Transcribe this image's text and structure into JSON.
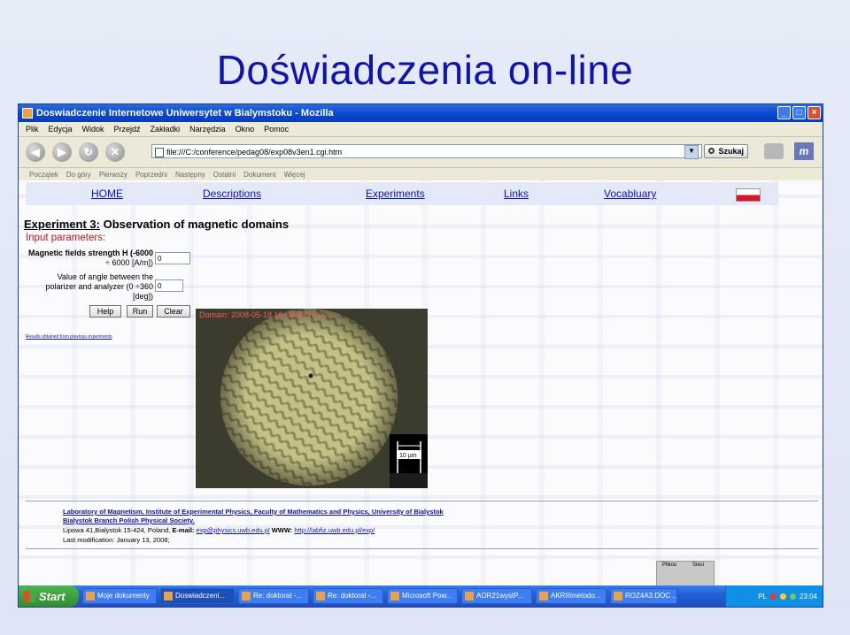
{
  "slide": {
    "title": "Doświadczenia on-line"
  },
  "window": {
    "title": "Doswiadczenie Internetowe Uniwersytet w Bialymstoku - Mozilla",
    "controls": [
      "_",
      "□",
      "×"
    ]
  },
  "menu": [
    "Plik",
    "Edycja",
    "Widok",
    "Przejdź",
    "Zakładki",
    "Narzędzia",
    "Okno",
    "Pomoc"
  ],
  "address": {
    "url": "file:///C:/conference/pedag08/exp08v3en1.cgi.htm",
    "search_label": "Szukaj"
  },
  "personal": [
    "Początek",
    "Do góry",
    "Pierwszy",
    "Poprzedni",
    "Następny",
    "Ostatni",
    "Dokument",
    "Więcej"
  ],
  "site_nav": [
    "HOME",
    "Descriptions",
    "Experiments",
    "Links",
    "Vocabluary"
  ],
  "experiment": {
    "title_prefix": "Experiment 3:",
    "title": "Observation of magnetic domains",
    "input_header": "Input parameters:",
    "field1_label_1": "Magnetic fields strength H (-6000",
    "field1_label_2": "÷ 6000 [A/m])",
    "field1_value": "0",
    "field2_label_1": "Value of angle between the",
    "field2_label_2": "polarizer and analyzer (0 ÷360",
    "field2_label_3": "[deg])",
    "field2_value": "0",
    "buttons": [
      "Help",
      "Run",
      "Clear"
    ],
    "prev_link": "Results obtained from previous experiments",
    "image_label": "Domain: 2008-05-18 16-09-39 H = 0",
    "scale_label": "10 µm"
  },
  "footer": {
    "line1": "Laboratory of Magnetism, Institute of Experimental Physics, Faculty of Mathematics and Physics, University of Bialystok",
    "line2": "Bialystok Branch Polish Physical Society.",
    "line3_prefix": "Lipowa 41,Bialystok 15-424, Poland, ",
    "email_label": "E-mail:",
    "email": "exp@physics.uwb.edu.pl",
    "www_label": "WWW:",
    "www": "http://labfiz.uwb.edu.pl/exp/",
    "line4": "Last modification: January 13, 2008;"
  },
  "net_widget": {
    "col1": "Plikou",
    "col2": "Sieci"
  },
  "taskbar": {
    "start": "Start",
    "tasks": [
      "Moje dokumenty",
      "Doswiadczeni...",
      "Re: doktorat -...",
      "Re: doktorat -...",
      "Microsoft Pow...",
      "AOR21wystP...",
      "AKRIIImetodo...",
      "ROZ4A3.DOC ..."
    ],
    "lang": "PL",
    "clock": "23:04"
  }
}
